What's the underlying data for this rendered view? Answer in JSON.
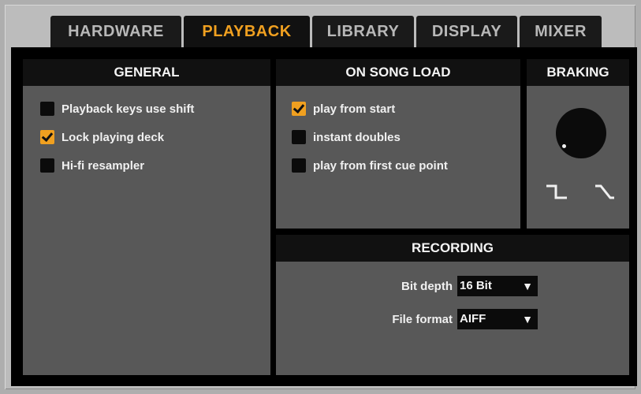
{
  "tabs": [
    "HARDWARE",
    "PLAYBACK",
    "LIBRARY",
    "DISPLAY",
    "MIXER"
  ],
  "active_tab": "PLAYBACK",
  "accent_color": "#f0a020",
  "general": {
    "title": "GENERAL",
    "items": [
      {
        "label": "Playback keys use shift",
        "checked": false
      },
      {
        "label": "Lock playing deck",
        "checked": true
      },
      {
        "label": "Hi-fi resampler",
        "checked": false
      }
    ]
  },
  "on_song_load": {
    "title": "ON SONG LOAD",
    "items": [
      {
        "label": "play from start",
        "checked": true
      },
      {
        "label": "instant doubles",
        "checked": false
      },
      {
        "label": "play from first cue point",
        "checked": false
      }
    ]
  },
  "braking": {
    "title": "BRAKING",
    "icons": [
      "braking-knob",
      "step-curve-icon",
      "ramp-curve-icon"
    ]
  },
  "recording": {
    "title": "RECORDING",
    "bit_depth_label": "Bit depth",
    "bit_depth_value": "16 Bit",
    "file_format_label": "File format",
    "file_format_value": "AIFF",
    "dropdown_arrow": "▼"
  }
}
